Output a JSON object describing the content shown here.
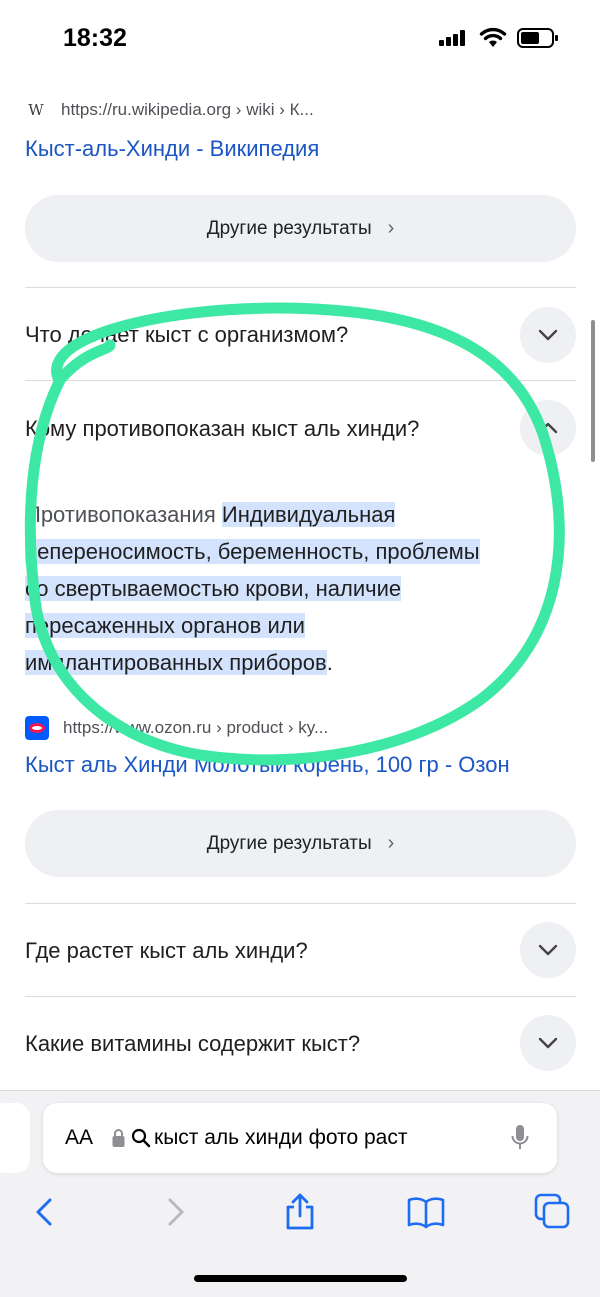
{
  "status_bar": {
    "time": "18:32"
  },
  "results": [
    {
      "source": "https://ru.wikipedia.org › wiki › К...",
      "favicon": "wikipedia-w-icon",
      "favicon_text": "W",
      "title": "Кыст-аль-Хинди - Википедия"
    },
    {
      "source": "https://www.ozon.ru › product › ky...",
      "favicon": "ozon-icon",
      "title": "Кыст аль Хинди Молотый корень, 100 гр - Озон"
    }
  ],
  "more_results_label": "Другие результаты",
  "faq": [
    {
      "question": "Что делает кыст с организмом?",
      "expanded": false
    },
    {
      "question": "Кому противопоказан кыст аль хинди?",
      "expanded": true
    },
    {
      "question": "Где растет кыст аль хинди?",
      "expanded": false
    },
    {
      "question": "Какие витамины содержит кыст?",
      "expanded": false
    }
  ],
  "answer": {
    "lead": "Противопоказания",
    "lines": [
      "Индивидуальная",
      "непереносимость, беременность, проблемы",
      "со свертываемостью крови, наличие",
      "пересаженных органов или",
      "имплантированных приборов"
    ],
    "tail": "."
  },
  "address_bar": {
    "aa_label": "AA",
    "text": "кыст аль хинди фото раст"
  },
  "colors": {
    "link": "#1a56c4",
    "highlight": "#d3e3fd",
    "marker": "#3de8a4",
    "pill": "#eff0f3"
  }
}
